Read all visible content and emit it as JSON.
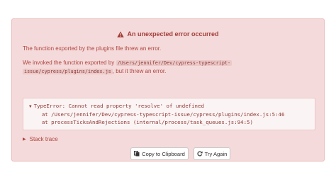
{
  "error": {
    "title": "An unexpected error occurred",
    "message_line1": "The function exported by the plugins file threw an error.",
    "invoked_prefix": "We invoked the function exported by",
    "plugin_path_part1": "/Users/jennifer/Dev/cypress-typescript-",
    "plugin_path_part2": "issue/cypress/plugins/index.js",
    "invoked_suffix": ", but it threw an error."
  },
  "stack": {
    "error_line": "TypeError: Cannot read property 'resolve' of undefined",
    "frame1": "at /Users/jennifer/Dev/cypress-typescript-issue/cypress/plugins/index.js:5:46",
    "frame2": "at processTicksAndRejections (internal/process/task_queues.js:94:5)",
    "toggle_label": "Stack trace"
  },
  "buttons": {
    "copy_label": "Copy to Clipboard",
    "retry_label": "Try Again"
  },
  "icons": {
    "title": "warning-triangle-icon",
    "copy": "copy-icon",
    "retry": "refresh-icon"
  },
  "colors": {
    "panel_bg": "#f4dada",
    "error_text": "#a33c38"
  }
}
